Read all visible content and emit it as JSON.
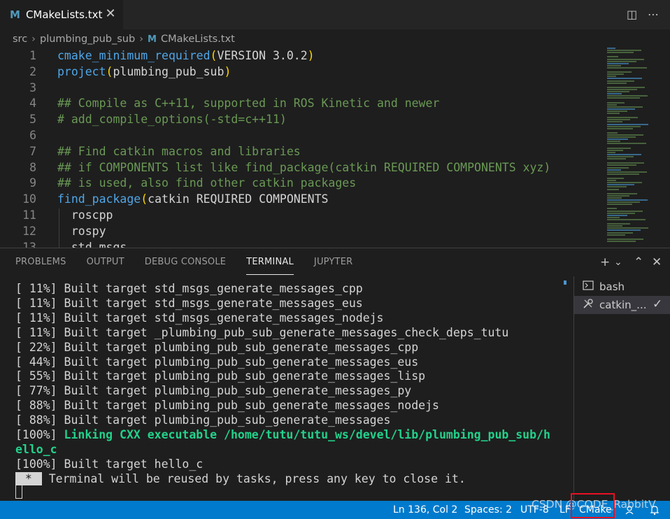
{
  "tab": {
    "icon": "cmake-m-icon",
    "title": "CMakeLists.txt",
    "close": "✕"
  },
  "toolbar": {
    "split": "◫",
    "more": "⋯"
  },
  "breadcrumb": {
    "parts": [
      "src",
      "plumbing_pub_sub",
      "CMakeLists.txt"
    ],
    "sep": "›"
  },
  "editor": {
    "lines": [
      {
        "n": "1",
        "parts": [
          [
            "fn",
            "cmake_minimum_required"
          ],
          [
            "pn",
            "("
          ],
          [
            "tx",
            "VERSION 3.0.2"
          ],
          [
            "pn",
            ")"
          ]
        ]
      },
      {
        "n": "2",
        "parts": [
          [
            "fn",
            "project"
          ],
          [
            "pn",
            "("
          ],
          [
            "tx",
            "plumbing_pub_sub"
          ],
          [
            "pn",
            ")"
          ]
        ]
      },
      {
        "n": "3",
        "parts": []
      },
      {
        "n": "4",
        "parts": [
          [
            "cm",
            "## Compile as C++11, supported in ROS Kinetic and newer"
          ]
        ]
      },
      {
        "n": "5",
        "parts": [
          [
            "cm",
            "# add_compile_options(-std=c++11)"
          ]
        ]
      },
      {
        "n": "6",
        "parts": []
      },
      {
        "n": "7",
        "parts": [
          [
            "cm",
            "## Find catkin macros and libraries"
          ]
        ]
      },
      {
        "n": "8",
        "parts": [
          [
            "cm",
            "## if COMPONENTS list like find_package(catkin REQUIRED COMPONENTS xyz)"
          ]
        ]
      },
      {
        "n": "9",
        "parts": [
          [
            "cm",
            "## is used, also find other catkin packages"
          ]
        ]
      },
      {
        "n": "10",
        "parts": [
          [
            "fn",
            "find_package"
          ],
          [
            "pn",
            "("
          ],
          [
            "tx",
            "catkin REQUIRED COMPONENTS"
          ]
        ]
      },
      {
        "n": "11",
        "parts": [
          [
            "tx",
            "  roscpp"
          ]
        ]
      },
      {
        "n": "12",
        "parts": [
          [
            "tx",
            "  rospy"
          ]
        ]
      },
      {
        "n": "13",
        "parts": [
          [
            "tx",
            "  std_msgs"
          ]
        ]
      }
    ]
  },
  "panel": {
    "tabs": [
      "PROBLEMS",
      "OUTPUT",
      "DEBUG CONSOLE",
      "TERMINAL",
      "JUPYTER"
    ],
    "active_tab": "TERMINAL",
    "actions": {
      "add": "+",
      "dropdown": "⌄",
      "maximize": "⌃",
      "close": "✕"
    }
  },
  "terminal": {
    "lines": [
      {
        "text": "[ 11%] Built target std_msgs_generate_messages_cpp",
        "style": "normal"
      },
      {
        "text": "[ 11%] Built target std_msgs_generate_messages_eus",
        "style": "normal"
      },
      {
        "text": "[ 11%] Built target std_msgs_generate_messages_nodejs",
        "style": "normal"
      },
      {
        "text": "[ 11%] Built target _plumbing_pub_sub_generate_messages_check_deps_tutu",
        "style": "normal"
      },
      {
        "text": "[ 22%] Built target plumbing_pub_sub_generate_messages_cpp",
        "style": "normal"
      },
      {
        "text": "[ 44%] Built target plumbing_pub_sub_generate_messages_eus",
        "style": "normal"
      },
      {
        "text": "[ 55%] Built target plumbing_pub_sub_generate_messages_lisp",
        "style": "normal"
      },
      {
        "text": "[ 77%] Built target plumbing_pub_sub_generate_messages_py",
        "style": "normal"
      },
      {
        "text": "[ 88%] Built target plumbing_pub_sub_generate_messages_nodejs",
        "style": "normal"
      },
      {
        "text": "[ 88%] Built target plumbing_pub_sub_generate_messages",
        "style": "normal"
      },
      {
        "prefix": "[100%] ",
        "text": "Linking CXX executable /home/tutu/tutu_ws/devel/lib/plumbing_pub_sub/h",
        "style": "green"
      },
      {
        "text": "ello_c",
        "style": "green"
      },
      {
        "text": "[100%] Built target hello_c",
        "style": "normal"
      }
    ],
    "notice_star": " * ",
    "notice": " Terminal will be reused by tasks, press any key to close it."
  },
  "terminal_list": [
    {
      "label": "bash",
      "icon": "terminal-icon"
    },
    {
      "label": "catkin_...",
      "icon": "tools-icon",
      "check": "✓"
    }
  ],
  "statusbar": {
    "position": "Ln 136, Col 2",
    "spaces": "Spaces: 2",
    "encoding": "UTF-8",
    "eol": "LF",
    "language": "CMake"
  },
  "watermark": "CSDN @CODE_RabbitV",
  "colors": {
    "statusbar": "#007acc",
    "highlight_box": "#e81123",
    "link_green": "#23d18b"
  }
}
